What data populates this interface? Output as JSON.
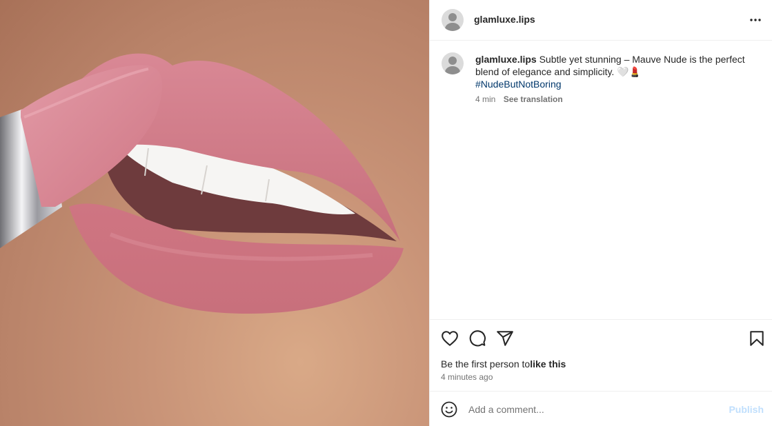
{
  "post": {
    "username": "glamluxe.lips",
    "caption": {
      "username": "glamluxe.lips",
      "text": "Subtle yet stunning – Mauve Nude is the perfect blend of elegance and simplicity. 🤍💄",
      "hashtag": "#NudeButNotBoring",
      "age": "4 min",
      "translate_label": "See translation"
    },
    "likes_prefix": "Be the first person to",
    "likes_action": "like this",
    "timestamp": "4 minutes ago"
  },
  "comment": {
    "placeholder": "Add a comment...",
    "publish_label": "Publish"
  },
  "icons": {
    "more": "more-options-icon",
    "like": "heart-icon",
    "comment": "comment-icon",
    "share": "share-icon",
    "save": "bookmark-icon",
    "emoji": "emoji-icon"
  },
  "colors": {
    "hashtag": "#00376b",
    "secondary_text": "#737373",
    "publish_disabled": "#c0dffd",
    "lipstick": "#d16f7d"
  }
}
